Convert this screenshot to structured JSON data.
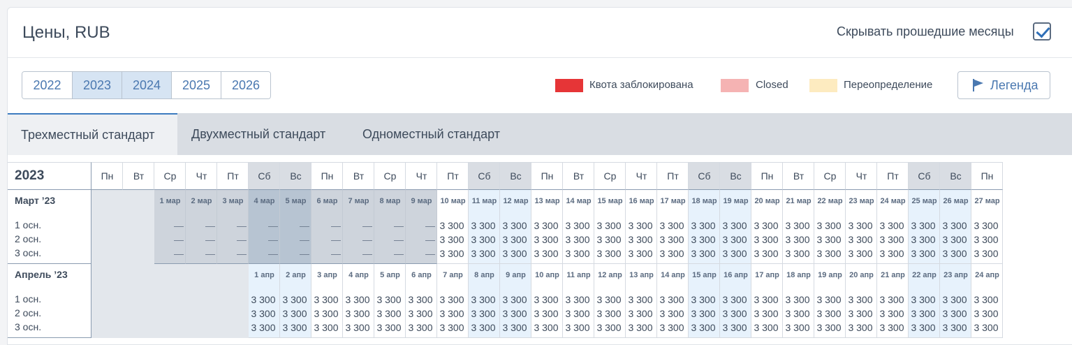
{
  "header": {
    "title": "Цены, RUB",
    "hide_past_label": "Скрывать прошедшие месяцы",
    "hide_past_checked": true
  },
  "years": [
    {
      "label": "2022",
      "active": false
    },
    {
      "label": "2023",
      "active": true
    },
    {
      "label": "2024",
      "active": true
    },
    {
      "label": "2025",
      "active": false
    },
    {
      "label": "2026",
      "active": false
    }
  ],
  "legend": {
    "items": [
      {
        "label": "Квота заблокирована",
        "color": "#e63537"
      },
      {
        "label": "Closed",
        "color": "#f5b3b3"
      },
      {
        "label": "Переопределение",
        "color": "#fdebc0"
      }
    ],
    "button_label": "Легенда"
  },
  "tabs": [
    {
      "label": "Трехместный стандарт",
      "active": true
    },
    {
      "label": "Двухместный стандарт",
      "active": false
    },
    {
      "label": "Одноместный стандарт",
      "active": false
    }
  ],
  "calendar": {
    "year_label": "2023",
    "weekdays": [
      "Пн",
      "Вт",
      "Ср",
      "Чт",
      "Пт",
      "Сб",
      "Вс",
      "Пн",
      "Вт",
      "Ср",
      "Чт",
      "Пт",
      "Сб",
      "Вс",
      "Пн",
      "Вт",
      "Ср",
      "Чт",
      "Пт",
      "Сб",
      "Вс",
      "Пн",
      "Вт",
      "Ср",
      "Чт",
      "Пт",
      "Сб",
      "Вс",
      "Пн"
    ],
    "colors": {
      "weekend_header": "#d9dde3",
      "blank": "#e3e7ec",
      "past": "#ced4dc",
      "past_weekend": "#b7c4d2",
      "weekend_future": "#e7f2fc",
      "text": "#3d4a5b",
      "date_text": "#5b6b80",
      "line": "#d5dae1",
      "dark_line": "#8a9bb0"
    },
    "row_labels": [
      "1 осн.",
      "2 осн.",
      "3 осн."
    ],
    "months": [
      {
        "label": "Март ’23",
        "blank_cols": 2,
        "days": [
          "1 мар",
          "2 мар",
          "3 мар",
          "4 мар",
          "5 мар",
          "6 мар",
          "7 мар",
          "8 мар",
          "9 мар",
          "10 мар",
          "11 мар",
          "12 мар",
          "13 мар",
          "14 мар",
          "15 мар",
          "16 мар",
          "17 мар",
          "18 мар",
          "19 мар",
          "20 мар",
          "21 мар",
          "22 мар",
          "23 мар",
          "24 мар",
          "25 мар",
          "26 мар",
          "27 мар"
        ],
        "past_count": 9,
        "past_value": "—",
        "price": "3 300"
      },
      {
        "label": "Апрель ’23",
        "blank_cols": 5,
        "days": [
          "1 апр",
          "2 апр",
          "3 апр",
          "4 апр",
          "5 апр",
          "6 апр",
          "7 апр",
          "8 апр",
          "9 апр",
          "10 апр",
          "11 апр",
          "12 апр",
          "13 апр",
          "14 апр",
          "15 апр",
          "16 апр",
          "17 апр",
          "18 апр",
          "19 апр",
          "20 апр",
          "21 апр",
          "22 апр",
          "23 апр",
          "24 апр"
        ],
        "past_count": 0,
        "past_value": "—",
        "price": "3 300"
      }
    ]
  }
}
